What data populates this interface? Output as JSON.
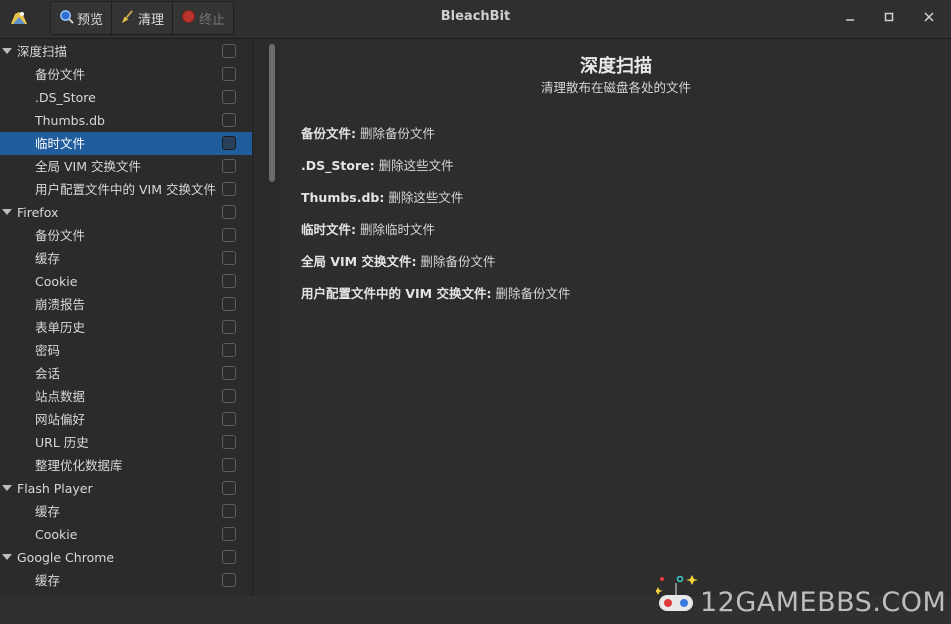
{
  "window": {
    "title": "BleachBit",
    "controls": [
      "minimize-icon",
      "maximize-icon",
      "close-icon"
    ]
  },
  "toolbar": {
    "preview_label": "预览",
    "clean_label": "清理",
    "abort_label": "终止"
  },
  "tree": [
    {
      "label": "深度扫描",
      "level": 0,
      "selected": false
    },
    {
      "label": "备份文件",
      "level": 1,
      "selected": false
    },
    {
      "label": ".DS_Store",
      "level": 1,
      "selected": false
    },
    {
      "label": "Thumbs.db",
      "level": 1,
      "selected": false
    },
    {
      "label": "临时文件",
      "level": 1,
      "selected": true
    },
    {
      "label": "全局 VIM 交换文件",
      "level": 1,
      "selected": false
    },
    {
      "label": "用户配置文件中的 VIM 交换文件",
      "level": 1,
      "selected": false
    },
    {
      "label": "Firefox",
      "level": 0,
      "selected": false
    },
    {
      "label": "备份文件",
      "level": 1,
      "selected": false
    },
    {
      "label": "缓存",
      "level": 1,
      "selected": false
    },
    {
      "label": "Cookie",
      "level": 1,
      "selected": false
    },
    {
      "label": "崩溃报告",
      "level": 1,
      "selected": false
    },
    {
      "label": "表单历史",
      "level": 1,
      "selected": false
    },
    {
      "label": "密码",
      "level": 1,
      "selected": false
    },
    {
      "label": "会话",
      "level": 1,
      "selected": false
    },
    {
      "label": "站点数据",
      "level": 1,
      "selected": false
    },
    {
      "label": "网站偏好",
      "level": 1,
      "selected": false
    },
    {
      "label": "URL 历史",
      "level": 1,
      "selected": false
    },
    {
      "label": "整理优化数据库",
      "level": 1,
      "selected": false
    },
    {
      "label": "Flash Player",
      "level": 0,
      "selected": false
    },
    {
      "label": "缓存",
      "level": 1,
      "selected": false
    },
    {
      "label": "Cookie",
      "level": 1,
      "selected": false
    },
    {
      "label": "Google Chrome",
      "level": 0,
      "selected": false
    },
    {
      "label": "缓存",
      "level": 1,
      "selected": false
    }
  ],
  "main": {
    "title": "深度扫描",
    "subtitle": "清理散布在磁盘各处的文件",
    "descriptions": [
      {
        "name": "备份文件:",
        "text": " 删除备份文件"
      },
      {
        "name": ".DS_Store:",
        "text": " 删除这些文件"
      },
      {
        "name": "Thumbs.db:",
        "text": " 删除这些文件"
      },
      {
        "name": "临时文件:",
        "text": " 删除临时文件"
      },
      {
        "name": "全局 VIM 交换文件:",
        "text": " 删除备份文件"
      },
      {
        "name": "用户配置文件中的 VIM 交换文件:",
        "text": " 删除备份文件"
      }
    ]
  },
  "watermark": {
    "text": "12GAMEBBS.COM"
  },
  "colors": {
    "background": "#2b2b2b",
    "selection": "#215d9c",
    "abort_icon": "#c0392b"
  }
}
